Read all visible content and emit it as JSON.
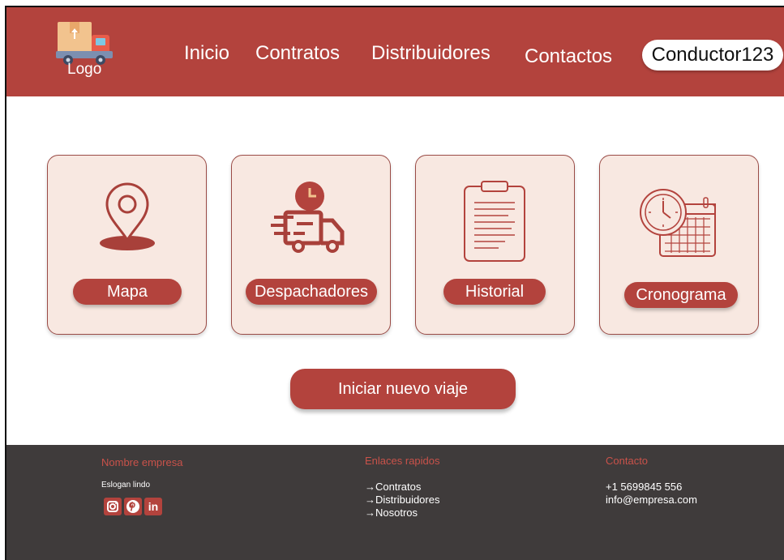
{
  "header": {
    "logo_label": "Logo",
    "nav": {
      "inicio": "Inicio",
      "contratos": "Contratos",
      "distribuidores": "Distribuidores",
      "contactos": "Contactos"
    },
    "user": "Conductor123"
  },
  "cards": {
    "mapa": {
      "label": "Mapa",
      "icon": "map-pin-icon"
    },
    "despachadores": {
      "label": "Despachadores",
      "icon": "delivery-truck-icon"
    },
    "historial": {
      "label": "Historial",
      "icon": "clipboard-icon"
    },
    "cronograma": {
      "label": "Cronograma",
      "icon": "clock-calendar-icon"
    }
  },
  "cta_label": "Iniciar nuevo viaje",
  "footer": {
    "company_heading": "Nombre empresa",
    "slogan": "Eslogan lindo",
    "links_heading": "Enlaces rapidos",
    "links": [
      "→Contratos",
      "→Distribuidores",
      "→Nosotros"
    ],
    "contact_heading": "Contacto",
    "phone": "+1 5699845 556",
    "email": "info@empresa.com",
    "social": [
      "instagram-icon",
      "pinterest-icon",
      "linkedin-icon"
    ]
  },
  "colors": {
    "brand": "#b3433d",
    "card_bg": "#f8e8e1",
    "footer_bg": "#3f3b3b",
    "footer_heading": "#c9524a"
  }
}
